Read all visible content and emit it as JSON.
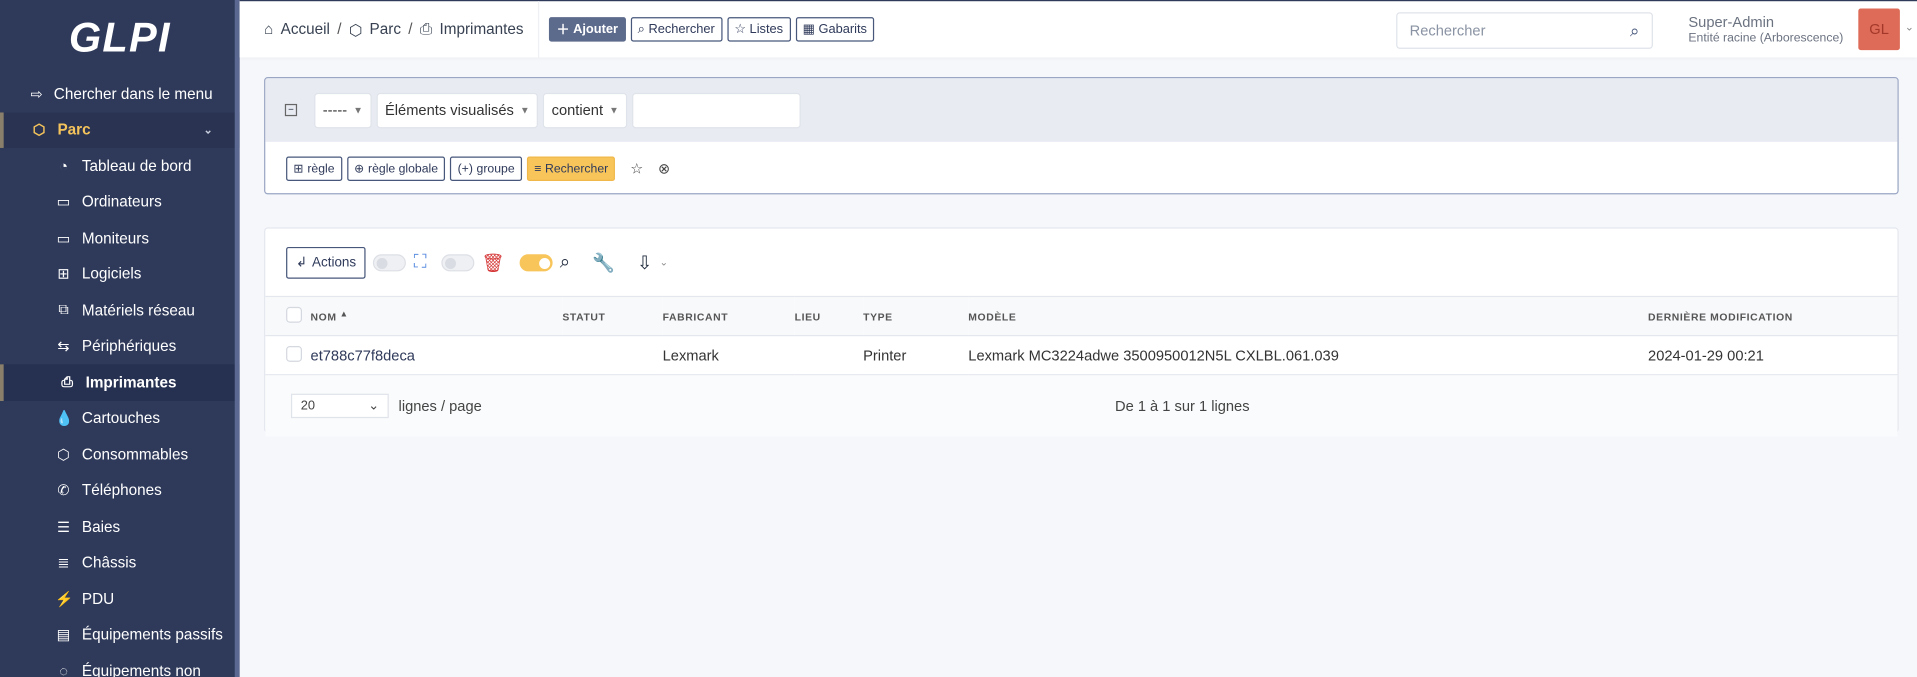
{
  "logo": "GLPI",
  "sidebar": {
    "search": "Chercher dans le menu",
    "section": "Parc",
    "items": [
      {
        "label": "Tableau de bord",
        "icon": "gauge-icon",
        "g": "◔"
      },
      {
        "label": "Ordinateurs",
        "icon": "laptop-icon",
        "g": "▭"
      },
      {
        "label": "Moniteurs",
        "icon": "monitor-icon",
        "g": "▭"
      },
      {
        "label": "Logiciels",
        "icon": "apps-icon",
        "g": "⊞"
      },
      {
        "label": "Matériels réseau",
        "icon": "network-icon",
        "g": "⧉"
      },
      {
        "label": "Périphériques",
        "icon": "usb-icon",
        "g": "⇆"
      },
      {
        "label": "Imprimantes",
        "icon": "printer-icon",
        "g": "⎙",
        "active": true
      },
      {
        "label": "Cartouches",
        "icon": "droplet-icon",
        "g": "💧"
      },
      {
        "label": "Consommables",
        "icon": "box-icon",
        "g": "⬡"
      },
      {
        "label": "Téléphones",
        "icon": "phone-icon",
        "g": "✆"
      },
      {
        "label": "Baies",
        "icon": "server-icon",
        "g": "☰"
      },
      {
        "label": "Châssis",
        "icon": "columns-icon",
        "g": "≣"
      },
      {
        "label": "PDU",
        "icon": "plug-icon",
        "g": "⚡"
      },
      {
        "label": "Équipements passifs",
        "icon": "rack-icon",
        "g": "▤"
      },
      {
        "label": "Équipements non",
        "icon": "device-icon",
        "g": "◌"
      }
    ]
  },
  "header": {
    "breadcrumb": [
      "Accueil",
      "Parc",
      "Imprimantes"
    ],
    "buttons": {
      "add": "Ajouter",
      "search": "Rechercher",
      "lists": "Listes",
      "templates": "Gabarits"
    },
    "search_placeholder": "Rechercher",
    "user": "Super-Admin",
    "entity": "Entité racine (Arborescence)",
    "avatar": "GL"
  },
  "search": {
    "field1": "-----",
    "field2": "Éléments visualisés",
    "operator": "contient",
    "value": "",
    "buttons": {
      "rule": "règle",
      "global_rule": "règle globale",
      "group": "groupe",
      "search": "Rechercher"
    }
  },
  "results": {
    "actions": "Actions",
    "columns": [
      "NOM",
      "STATUT",
      "FABRICANT",
      "LIEU",
      "TYPE",
      "MODÈLE",
      "DERNIÈRE MODIFICATION"
    ],
    "rows": [
      [
        "et788c77f8deca",
        "",
        "Lexmark",
        "",
        "Printer",
        "Lexmark MC3224adwe 3500950012N5L CXLBL.061.039",
        "2024-01-29 00:21"
      ]
    ],
    "page_size": "20",
    "per_page_label": "lignes / page",
    "count": "De 1 à 1 sur 1 lignes"
  }
}
